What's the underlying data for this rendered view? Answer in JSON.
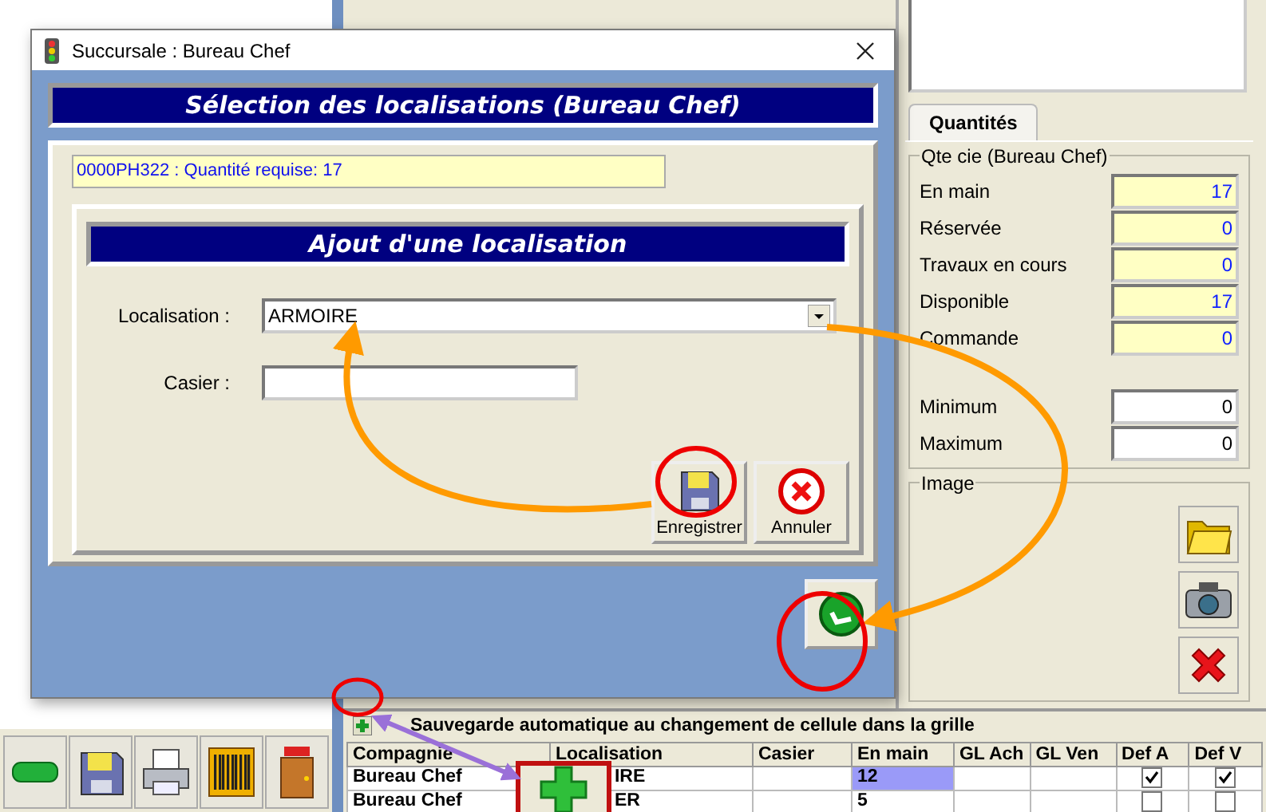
{
  "dialog": {
    "title": "Succursale : Bureau Chef",
    "header": "Sélection des localisations (Bureau Chef)",
    "info": "0000PH322 : Quantité requise: 17",
    "subheader": "Ajout d'une localisation",
    "fields": [
      {
        "label": "Localisation :",
        "value": "ARMOIRE",
        "kind": "dropdown"
      },
      {
        "label": "Casier :",
        "kind": "text"
      }
    ],
    "buttons": [
      {
        "label": "Enregistrer",
        "kind": "save"
      },
      {
        "label": "Annuler",
        "kind": "cancel"
      }
    ]
  },
  "quantities": {
    "tabs": [
      {
        "label": "Quantités",
        "selected": true
      }
    ],
    "group": "Qte cie (Bureau Chef)",
    "rows": [
      {
        "label": "En main",
        "value": "17",
        "kind": "computed"
      },
      {
        "label": "Réservée",
        "value": "0",
        "kind": "computed"
      },
      {
        "label": "Travaux en cours",
        "value": "0",
        "kind": "computed"
      },
      {
        "label": "Disponible",
        "value": "17",
        "kind": "computed"
      },
      {
        "label": "Commande",
        "value": "0",
        "kind": "computed"
      },
      {
        "label": "Minimum",
        "value": "0",
        "kind": "editable"
      },
      {
        "label": "Maximum",
        "value": "0",
        "kind": "editable"
      }
    ]
  },
  "image_panel": {
    "title": "Image"
  },
  "grid": {
    "autosave": "Sauvegarde automatique au changement de cellule dans la grille",
    "columns": [
      "Compagnie",
      "Localisation",
      "Casier",
      "En main",
      "GL Ach",
      "GL Ven",
      "Def A",
      "Def V"
    ],
    "rows": [
      {
        "company": "Bureau Chef",
        "location": "IRE",
        "on_hand": "12",
        "selected": true,
        "def_a": true,
        "def_v": true
      },
      {
        "company": "Bureau Chef",
        "location": "ER",
        "on_hand": "5",
        "selected": false,
        "def_a": false,
        "def_v": false
      }
    ]
  }
}
